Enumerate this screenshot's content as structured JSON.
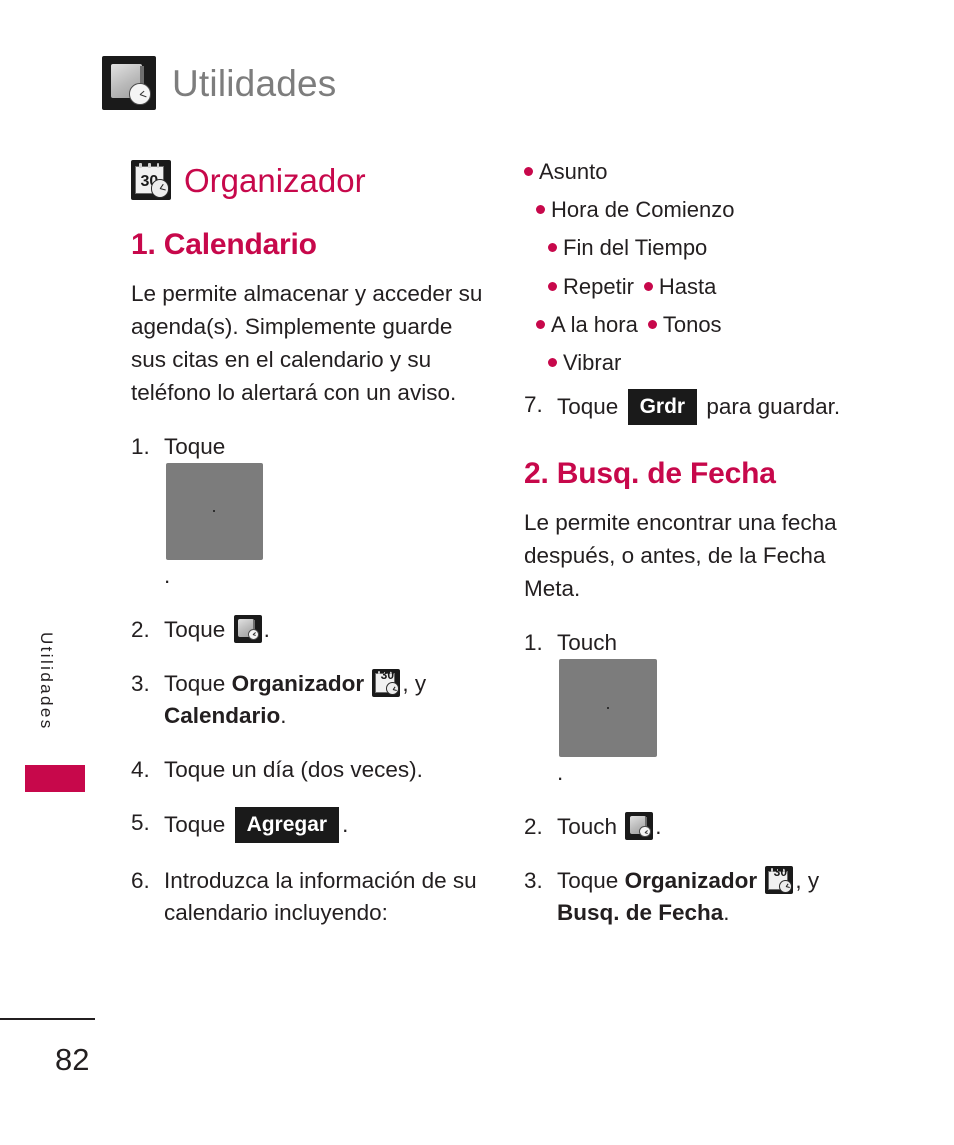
{
  "header": {
    "title": "Utilidades",
    "icon": "utilities-clock-icon"
  },
  "side_tab": {
    "label": "Utilidades",
    "accent_color": "#c7084b"
  },
  "colors": {
    "accent": "#c7084b",
    "header_gray": "#7d7d7d",
    "text": "#231f20",
    "badge_bg": "#1a1a1a"
  },
  "left_column": {
    "section": {
      "title": "Organizador",
      "icon": "calendar-clock-icon"
    },
    "heading": "1. Calendario",
    "intro": "Le permite almacenar y acceder su agenda(s). Simplemente guarde sus citas en el calendario y su teléfono lo alertará con un aviso.",
    "steps": [
      {
        "num": "1.",
        "pre": "Toque ",
        "icon": "grid-menu-icon",
        "bold": "",
        "post": "."
      },
      {
        "num": "2.",
        "pre": "Toque ",
        "icon": "utilities-clock-icon",
        "bold": "",
        "post": "."
      },
      {
        "num": "3.",
        "pre": "Toque ",
        "bold": "Organizador",
        "icon": "calendar-clock-icon",
        "post": ", y ",
        "bold2": "Calendario",
        "post2": "."
      },
      {
        "num": "4.",
        "pre": "Toque un día (dos veces).",
        "icon": "",
        "bold": "",
        "post": ""
      },
      {
        "num": "5.",
        "pre": "Toque ",
        "key": "Agregar",
        "icon": "",
        "bold": "",
        "post": "."
      },
      {
        "num": "6.",
        "pre": "Introduzca la información de su calendario incluyendo:",
        "icon": "",
        "bold": "",
        "post": ""
      }
    ]
  },
  "right_column": {
    "bullets": [
      {
        "label": "Asunto",
        "indent": 0
      },
      {
        "label": "Hora de Comienzo",
        "indent": 1
      },
      {
        "label": "Fin del Tiempo",
        "indent": 1
      },
      {
        "label": "Repetir",
        "label2": "Hasta",
        "indent": 2
      },
      {
        "label": "A la hora",
        "label2": "Tonos",
        "indent": 2
      },
      {
        "label": "Vibrar",
        "indent": 3
      }
    ],
    "step7": {
      "num": "7.",
      "pre": "Toque ",
      "key": "Grdr",
      "post": " para guardar."
    },
    "heading": "2. Busq. de Fecha",
    "intro": "Le permite encontrar una fecha después, o antes, de la Fecha Meta.",
    "steps": [
      {
        "num": "1.",
        "pre": "Touch ",
        "icon": "grid-menu-icon",
        "bold": "",
        "post": "."
      },
      {
        "num": "2.",
        "pre": "Touch ",
        "icon": "utilities-clock-icon",
        "bold": "",
        "post": "."
      },
      {
        "num": "3.",
        "pre": "Toque ",
        "bold": "Organizador",
        "icon": "calendar-clock-icon",
        "post": ", y ",
        "bold2": "Busq. de Fecha",
        "post2": "."
      }
    ]
  },
  "footer": {
    "page_number": "82"
  },
  "icons": {
    "calendar_day_number": "30"
  }
}
